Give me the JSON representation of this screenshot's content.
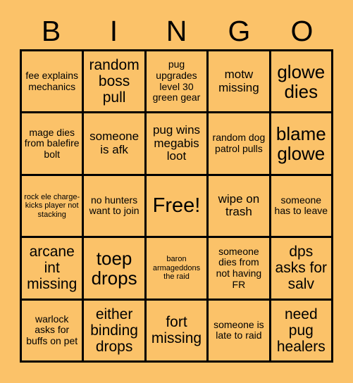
{
  "card": {
    "title_letters": [
      "B",
      "I",
      "N",
      "G",
      "O"
    ],
    "background_color": "#fbc269",
    "border_color": "#000000",
    "text_color": "#000000",
    "columns": 5,
    "rows": 5,
    "free_space_label": "Free!",
    "cells": [
      {
        "text": "fee explains mechanics",
        "size": "s"
      },
      {
        "text": "random boss pull",
        "size": "l"
      },
      {
        "text": "pug upgrades level 30 green gear",
        "size": "s"
      },
      {
        "text": "motw missing",
        "size": "m"
      },
      {
        "text": "glowe dies",
        "size": "xl"
      },
      {
        "text": "mage dies from balefire bolt",
        "size": "s"
      },
      {
        "text": "someone is afk",
        "size": "m"
      },
      {
        "text": "pug wins megabis loot",
        "size": "m"
      },
      {
        "text": "random dog patrol pulls",
        "size": "s"
      },
      {
        "text": "blame glowe",
        "size": "xl"
      },
      {
        "text": "rock ele charge-kicks player not stacking",
        "size": "xs"
      },
      {
        "text": "no hunters want to join",
        "size": "s"
      },
      {
        "text": "Free!",
        "size": "free"
      },
      {
        "text": "wipe on trash",
        "size": "m"
      },
      {
        "text": "someone has to leave",
        "size": "s"
      },
      {
        "text": "arcane int missing",
        "size": "l"
      },
      {
        "text": "toep drops",
        "size": "xl"
      },
      {
        "text": "baron armageddons the raid",
        "size": "xs"
      },
      {
        "text": "someone dies from not having FR",
        "size": "s"
      },
      {
        "text": "dps asks for salv",
        "size": "l"
      },
      {
        "text": "warlock asks for buffs on pet",
        "size": "s"
      },
      {
        "text": "either binding drops",
        "size": "l"
      },
      {
        "text": "fort missing",
        "size": "l"
      },
      {
        "text": "someone is late to raid",
        "size": "s"
      },
      {
        "text": "need pug healers",
        "size": "l"
      }
    ]
  }
}
